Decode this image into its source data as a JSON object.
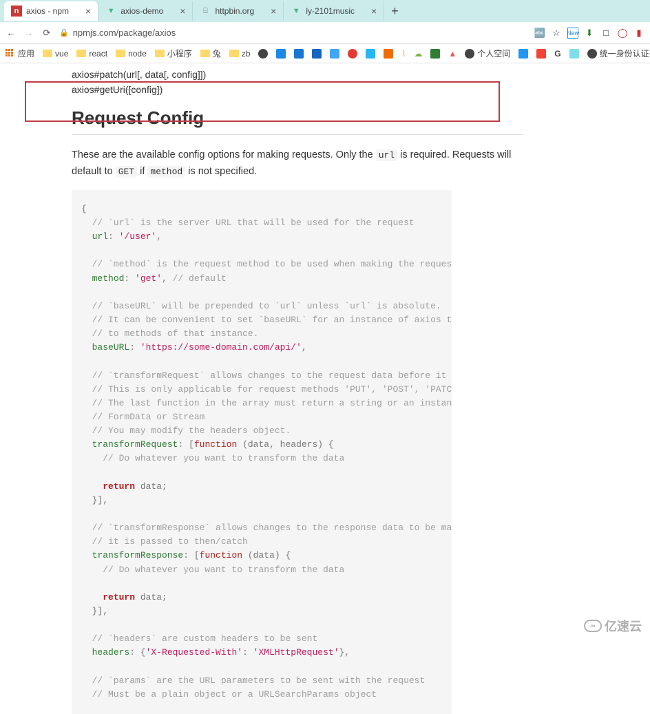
{
  "browser": {
    "tabs": [
      {
        "title": "axios - npm",
        "icon": "npm",
        "active": true
      },
      {
        "title": "axios-demo",
        "icon": "vue",
        "active": false
      },
      {
        "title": "httpbin.org",
        "icon": "db",
        "active": false
      },
      {
        "title": "ly-2101music",
        "icon": "vue",
        "active": false
      }
    ],
    "url": "npmjs.com/package/axios",
    "bookmarks": [
      {
        "label": "应用",
        "type": "grid"
      },
      {
        "label": "vue",
        "type": "folder"
      },
      {
        "label": "react",
        "type": "folder"
      },
      {
        "label": "node",
        "type": "folder"
      },
      {
        "label": "小程序",
        "type": "folder"
      },
      {
        "label": "兔",
        "type": "folder"
      },
      {
        "label": "zb",
        "type": "folder"
      },
      {
        "label": "",
        "type": "globe"
      },
      {
        "label": "",
        "type": "paw"
      },
      {
        "label": "",
        "type": "yi"
      },
      {
        "label": "",
        "type": "zhi"
      },
      {
        "label": "",
        "type": "fan"
      },
      {
        "label": "",
        "type": "weibo"
      },
      {
        "label": "",
        "type": "bili"
      },
      {
        "label": "",
        "type": "csq"
      },
      {
        "label": "",
        "type": "wave"
      },
      {
        "label": "",
        "type": "cloud"
      },
      {
        "label": "",
        "type": "flag"
      },
      {
        "label": "",
        "type": "fire"
      },
      {
        "label": "个人空间",
        "type": "globe"
      },
      {
        "label": "",
        "type": "h"
      },
      {
        "label": "",
        "type": "yt"
      },
      {
        "label": "",
        "type": "g"
      },
      {
        "label": "",
        "type": "mi"
      },
      {
        "label": "统一身份认证平台",
        "type": "globe"
      }
    ]
  },
  "page": {
    "api_lines": [
      "axios#patch(url[, data[, config]])",
      "axios#getUri([config])"
    ],
    "heading": "Request Config",
    "intro_parts": {
      "p1": "These are the available config options for making requests. Only the ",
      "code1": "url",
      "p2": " is required. Requests will default to ",
      "code2": "GET",
      "p3": " if ",
      "code3": "method",
      "p4": " is not specified."
    },
    "code": {
      "l1": "{",
      "l2": "  // `url` is the server URL that will be used for the request",
      "l3a": "  ",
      "l3k": "url",
      "l3b": ": ",
      "l3s": "'/user'",
      "l3c": ",",
      "l4": "",
      "l5": "  // `method` is the request method to be used when making the request",
      "l6a": "  ",
      "l6k": "method",
      "l6b": ": ",
      "l6s": "'get'",
      "l6c": ", ",
      "l6cm": "// default",
      "l7": "",
      "l8": "  // `baseURL` will be prepended to `url` unless `url` is absolute.",
      "l9": "  // It can be convenient to set `baseURL` for an instance of axios to pass relative URLs",
      "l10": "  // to methods of that instance.",
      "l11a": "  ",
      "l11k": "baseURL",
      "l11b": ": ",
      "l11s": "'https://some-domain.com/api/'",
      "l11c": ",",
      "l12": "",
      "l13": "  // `transformRequest` allows changes to the request data before it is sent to the server",
      "l14": "  // This is only applicable for request methods 'PUT', 'POST', 'PATCH' and 'DELETE'",
      "l15": "  // The last function in the array must return a string or an instance of Buffer, ArrayBu",
      "l16": "  // FormData or Stream",
      "l17": "  // You may modify the headers object.",
      "l18a": "  ",
      "l18k": "transformRequest",
      "l18b": ": [",
      "l18f": "function",
      "l18c": " (data, headers) {",
      "l19": "    // Do whatever you want to transform the data",
      "l20": "",
      "l21a": "    ",
      "l21r": "return",
      "l21b": " data;",
      "l22": "  }],",
      "l23": "",
      "l24": "  // `transformResponse` allows changes to the response data to be made before",
      "l25": "  // it is passed to then/catch",
      "l26a": "  ",
      "l26k": "transformResponse",
      "l26b": ": [",
      "l26f": "function",
      "l26c": " (data) {",
      "l27": "    // Do whatever you want to transform the data",
      "l28": "",
      "l29a": "    ",
      "l29r": "return",
      "l29b": " data;",
      "l30": "  }],",
      "l31": "",
      "l32": "  // `headers` are custom headers to be sent",
      "l33a": "  ",
      "l33k": "headers",
      "l33b": ": {",
      "l33s1": "'X-Requested-With'",
      "l33c": ": ",
      "l33s2": "'XMLHttpRequest'",
      "l33d": "},",
      "l34": "",
      "l35": "  // `params` are the URL parameters to be sent with the request",
      "l36": "  // Must be a plain object or a URLSearchParams object"
    }
  },
  "watermark": "亿速云"
}
